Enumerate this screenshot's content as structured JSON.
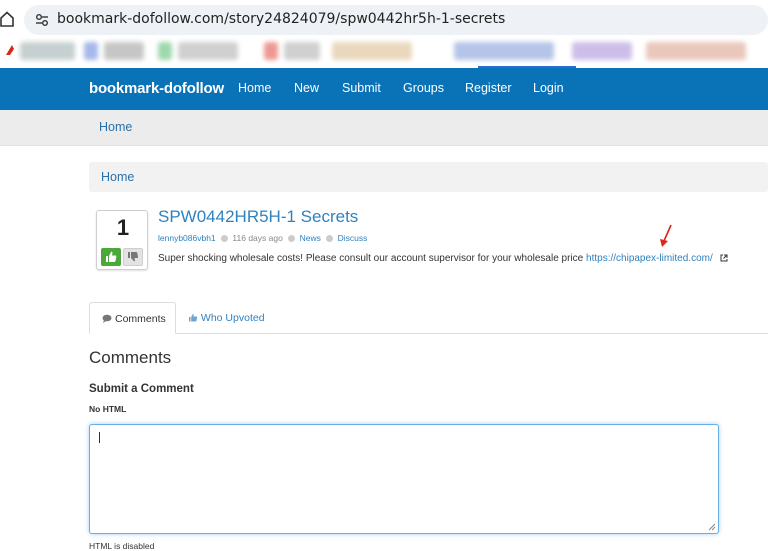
{
  "browser": {
    "url": "bookmark-dofollow.com/story24824079/spw0442hr5h-1-secrets"
  },
  "navbar": {
    "brand": "bookmark-dofollow",
    "links": [
      "Home",
      "New",
      "Submit",
      "Groups",
      "Register",
      "Login"
    ]
  },
  "subbar": {
    "home": "Home"
  },
  "breadcrumb": {
    "home": "Home"
  },
  "story": {
    "votes": "1",
    "title": "SPW0442HR5H-1 Secrets",
    "author": "lennyb086vbh1",
    "age": "116 days ago",
    "category": "News",
    "discuss": "Discuss",
    "description": "Super shocking wholesale costs! Please consult our account supervisor for your wholesale price",
    "link": "https://chipapex-limited.com/"
  },
  "tabs": {
    "comments": "Comments",
    "upvoted": "Who Upvoted"
  },
  "comments": {
    "heading": "Comments",
    "submit_heading": "Submit a Comment",
    "no_html": "No HTML",
    "html_disabled": "HTML is disabled"
  },
  "colors": {
    "navbar": "#0a72b7",
    "link": "#2f82c0",
    "upvote": "#4ca83a"
  }
}
